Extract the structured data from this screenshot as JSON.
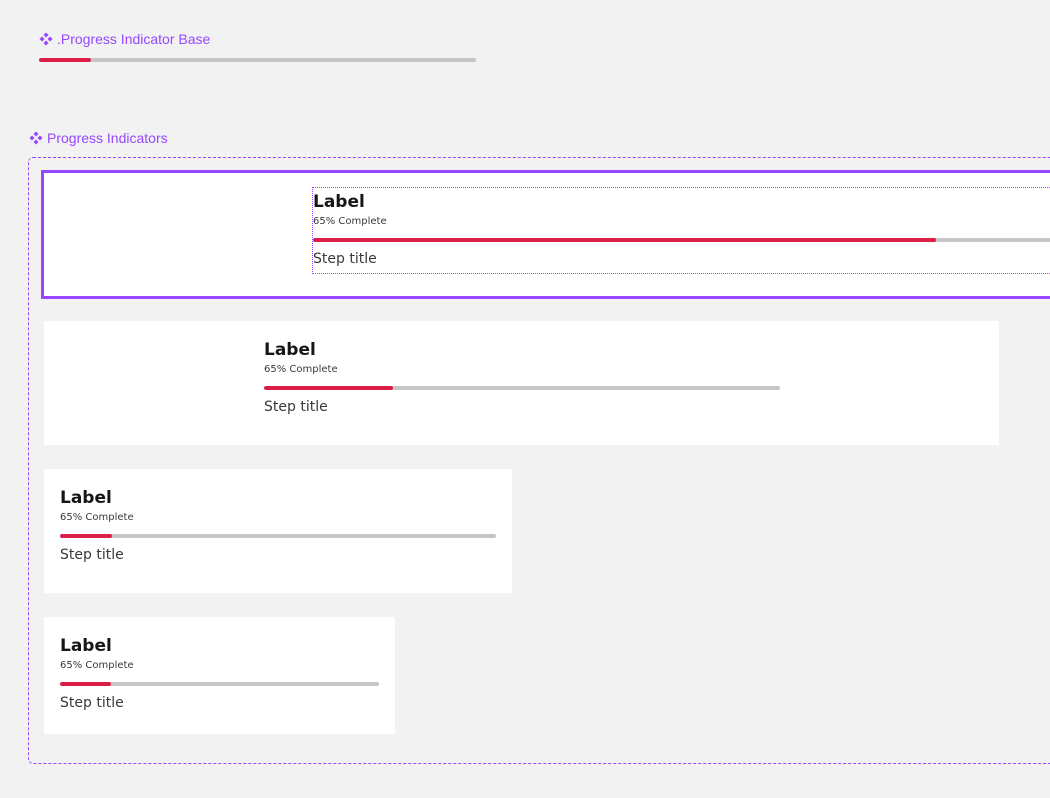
{
  "base_component": {
    "title": ".Progress Indicator Base",
    "icon": "component-diamond-icon",
    "progress": 0.12
  },
  "variants_group": {
    "title": "Progress Indicators",
    "icon": "component-diamond-icon"
  },
  "colors": {
    "accent_purple": "#9747ff",
    "progress_fill": "#da1e48",
    "progress_track": "#c6c6c6",
    "card_bg": "#ffffff",
    "canvas_bg": "#f2f2f2"
  },
  "indicators": [
    {
      "label": "Label",
      "helper": "65% Complete",
      "step_title": "Step title",
      "progress": 0.82,
      "selected": true
    },
    {
      "label": "Label",
      "helper": "65% Complete",
      "step_title": "Step title",
      "progress": 0.25,
      "selected": false
    },
    {
      "label": "Label",
      "helper": "65% Complete",
      "step_title": "Step title",
      "progress": 0.12,
      "selected": false
    },
    {
      "label": "Label",
      "helper": "65% Complete",
      "step_title": "Step title",
      "progress": 0.16,
      "selected": false
    }
  ]
}
